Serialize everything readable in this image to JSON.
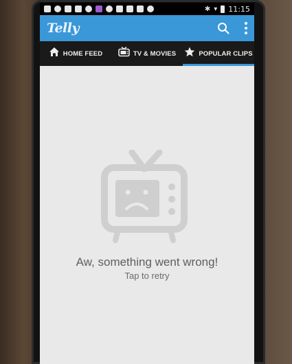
{
  "status_bar": {
    "time": "11:15"
  },
  "app_bar": {
    "logo": "Telly"
  },
  "tabs": [
    {
      "label": "HOME FEED",
      "active": false
    },
    {
      "label": "TV & MOVIES",
      "active": false
    },
    {
      "label": "POPULAR CLIPS",
      "active": true
    }
  ],
  "error": {
    "title": "Aw, something went wrong!",
    "retry": "Tap to retry"
  },
  "colors": {
    "accent": "#3a97d8",
    "tab_bar": "#1a1a1a",
    "content_bg": "#e9e9e9"
  }
}
